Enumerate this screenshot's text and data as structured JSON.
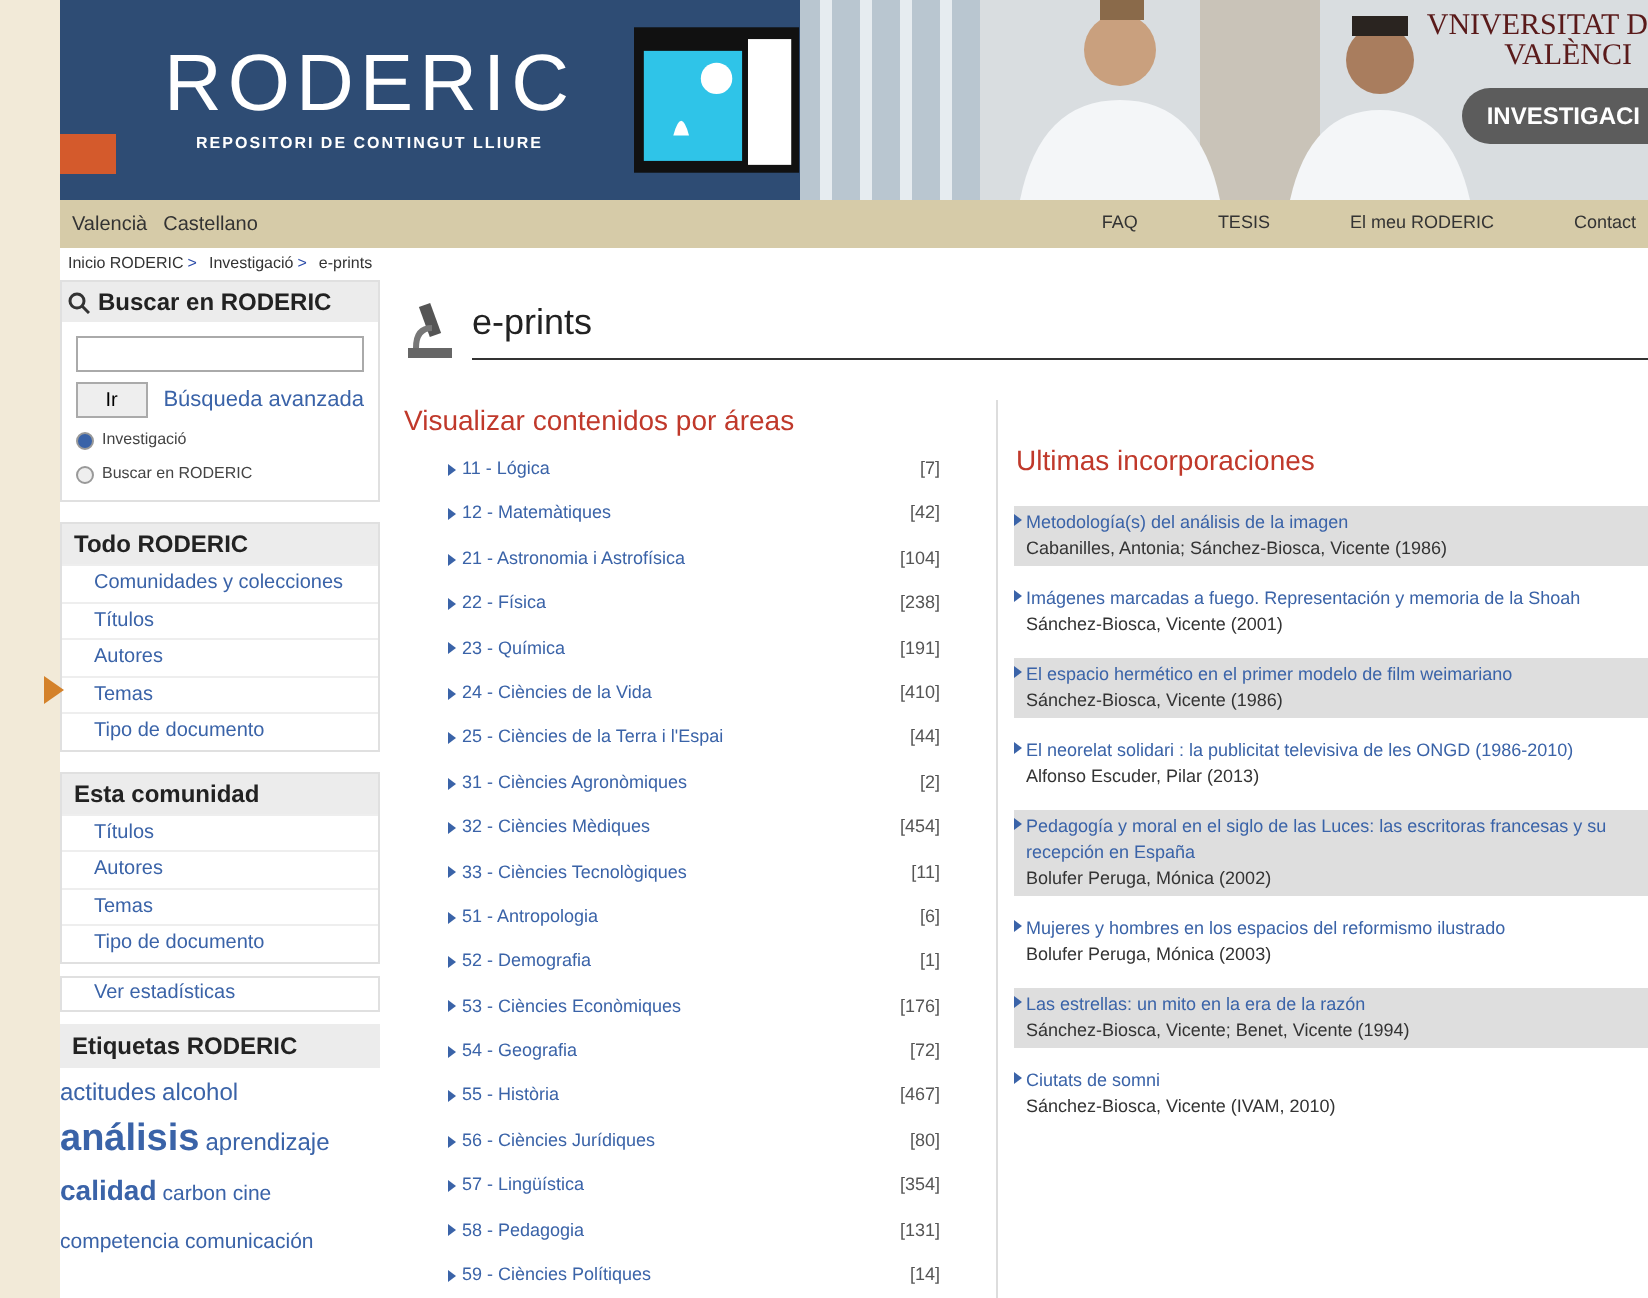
{
  "header": {
    "logo": "RODERIC",
    "tagline": "REPOSITORI DE CONTINGUT LLIURE",
    "university_line_1": "VNIVERSITAT D",
    "university_line_2": "VALÈNCI",
    "section_button": "INVESTIGACI"
  },
  "nav": {
    "languages": [
      "Valencià",
      "Castellano"
    ],
    "links": [
      "FAQ",
      "TESIS",
      "El meu RODERIC",
      "Contact"
    ]
  },
  "breadcrumb": [
    {
      "label": "Inicio RODERIC",
      "sep": ">"
    },
    {
      "label": "Investigació",
      "sep": ">"
    },
    {
      "label": "e-prints"
    }
  ],
  "sidebar": {
    "search": {
      "title": "Buscar en RODERIC",
      "go": "Ir",
      "advanced": "Búsqueda avanzada",
      "scopes": [
        {
          "label": "Investigació",
          "selected": true
        },
        {
          "label": "Buscar en RODERIC",
          "selected": false
        }
      ]
    },
    "sections": [
      {
        "title": "Todo RODERIC",
        "items": [
          "Comunidades y colecciones",
          "Títulos",
          "Autores",
          "Temas",
          "Tipo de documento"
        ]
      },
      {
        "title": "Esta comunidad",
        "items": [
          "Títulos",
          "Autores",
          "Temas",
          "Tipo de documento"
        ]
      }
    ],
    "stats": "Ver estadísticas",
    "tags_title": "Etiquetas RODERIC",
    "tags": [
      {
        "label": "actitudes",
        "kind": "small"
      },
      {
        "label": "alcohol",
        "kind": "small"
      },
      {
        "label": "análisis",
        "kind": "large"
      },
      {
        "label": "aprendizaje",
        "kind": "small"
      },
      {
        "label": "calidad",
        "kind": "medium"
      },
      {
        "label": "carbon",
        "kind": "tiny"
      },
      {
        "label": "cine",
        "kind": "tiny"
      },
      {
        "label": "competencia",
        "kind": "tiny"
      },
      {
        "label": "comunicación",
        "kind": "tiny"
      }
    ]
  },
  "page_title": "e-prints",
  "areas": {
    "title": "Visualizar contenidos por áreas",
    "items": [
      {
        "label": "11 - Lógica",
        "count": "[7]"
      },
      {
        "label": "12 - Matemàtiques",
        "count": "[42]"
      },
      {
        "label": "21 - Astronomia i Astrofísica",
        "count": "[104]"
      },
      {
        "label": "22 - Física",
        "count": "[238]"
      },
      {
        "label": "23 - Química",
        "count": "[191]"
      },
      {
        "label": "24 - Ciències de la Vida",
        "count": "[410]"
      },
      {
        "label": "25 - Ciències de la Terra i l'Espai",
        "count": "[44]"
      },
      {
        "label": "31 - Ciències Agronòmiques",
        "count": "[2]"
      },
      {
        "label": "32 - Ciències Mèdiques",
        "count": "[454]"
      },
      {
        "label": "33 - Ciències Tecnològiques",
        "count": "[11]"
      },
      {
        "label": "51 - Antropologia",
        "count": "[6]"
      },
      {
        "label": "52 - Demografia",
        "count": "[1]"
      },
      {
        "label": "53 - Ciències Econòmiques",
        "count": "[176]"
      },
      {
        "label": "54 - Geografia",
        "count": "[72]"
      },
      {
        "label": "55 - Història",
        "count": "[467]"
      },
      {
        "label": "56 - Ciències Jurídiques",
        "count": "[80]"
      },
      {
        "label": "57 - Lingüística",
        "count": "[354]"
      },
      {
        "label": "58 - Pedagogia",
        "count": "[131]"
      },
      {
        "label": "59 - Ciències Polítiques",
        "count": "[14]"
      }
    ]
  },
  "recent": {
    "title": "Ultimas incorporaciones",
    "items": [
      {
        "title": "Metodología(s) del análisis de la imagen",
        "authors": "Cabanilles, Antonia; Sánchez-Biosca, Vicente (1986)"
      },
      {
        "title": "Imágenes marcadas a fuego. Representación y memoria de la Shoah",
        "authors": "Sánchez-Biosca, Vicente (2001)"
      },
      {
        "title": "El espacio hermético en el primer modelo de film weimariano",
        "authors": "Sánchez-Biosca, Vicente (1986)"
      },
      {
        "title": "El neorelat solidari : la publicitat televisiva de les ONGD (1986-2010)",
        "authors": "Alfonso Escuder, Pilar (2013)"
      },
      {
        "title": "Pedagogía y moral en el siglo de las Luces: las escritoras francesas y su recepción en España",
        "authors": "Bolufer Peruga, Mónica (2002)"
      },
      {
        "title": "Mujeres y hombres en los espacios del reformismo ilustrado",
        "authors": "Bolufer Peruga, Mónica (2003)"
      },
      {
        "title": "Las estrellas: un mito en la era de la razón",
        "authors": "Sánchez-Biosca, Vicente; Benet, Vicente (1994)"
      },
      {
        "title": "Ciutats de somni",
        "authors": "Sánchez-Biosca, Vicente (IVAM, 2010)"
      }
    ]
  }
}
